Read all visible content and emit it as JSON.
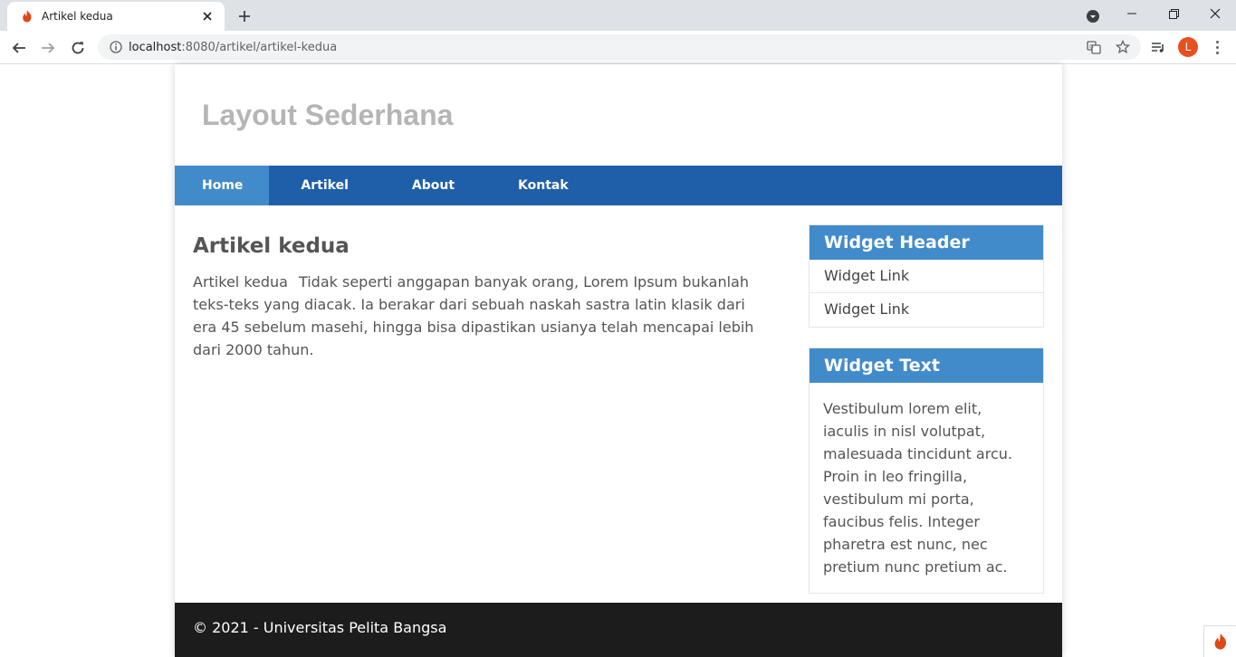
{
  "browser": {
    "tab_title": "Artikel kedua",
    "new_tab_label": "+",
    "url_host": "localhost",
    "url_rest": ":8080/artikel/artikel-kedua",
    "avatar_letter": "L",
    "icons": [
      "fire-favicon",
      "close-icon",
      "plus-icon",
      "tab-search-icon",
      "minimize-icon",
      "maximize-icon",
      "window-close-icon",
      "back-icon",
      "forward-icon",
      "reload-icon",
      "info-icon",
      "translate-icon",
      "star-icon",
      "media-queue-icon",
      "kebab-menu-icon"
    ]
  },
  "site": {
    "title": "Layout Sederhana",
    "nav": [
      {
        "label": "Home",
        "active": true
      },
      {
        "label": "Artikel",
        "active": false
      },
      {
        "label": "About",
        "active": false
      },
      {
        "label": "Kontak",
        "active": false
      }
    ],
    "accent_color": "#428bca",
    "nav_color": "#1f5faa"
  },
  "article": {
    "title": "Artikel kedua",
    "image_alt": "Artikel kedua",
    "text": "Tidak seperti anggapan banyak orang, Lorem Ipsum bukanlah teks-teks yang diacak. Ia berakar dari sebuah naskah sastra latin klasik dari era 45 sebelum masehi, hingga bisa dipastikan usianya telah mencapai lebih dari 2000 tahun."
  },
  "sidebar": {
    "widget_links": {
      "header": "Widget Header",
      "links": [
        "Widget Link",
        "Widget Link"
      ]
    },
    "widget_text": {
      "header": "Widget Text",
      "text": "Vestibulum lorem elit, iaculis in nisl volutpat, malesuada tincidunt arcu. Proin in leo fringilla, vestibulum mi porta, faucibus felis. Integer pharetra est nunc, nec pretium nunc pretium ac."
    }
  },
  "footer": {
    "text": "© 2021 - Universitas Pelita Bangsa"
  }
}
